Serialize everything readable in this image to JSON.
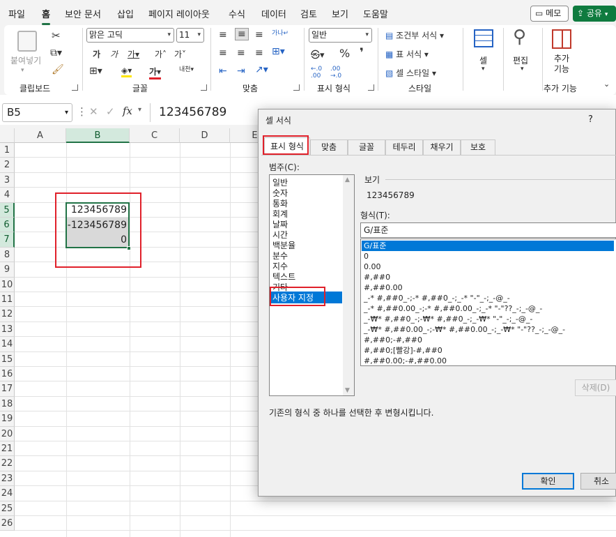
{
  "menu": {
    "tabs": [
      "파일",
      "홈",
      "보안 문서",
      "삽입",
      "페이지 레이아웃",
      "수식",
      "데이터",
      "검토",
      "보기",
      "도움말"
    ],
    "active_tab": "홈",
    "memo_label": "메모",
    "share_label": "공유"
  },
  "ribbon": {
    "paste_label": "붙여넣기",
    "font_name": "맑은 고딕",
    "font_size": "11",
    "number_format": "일반",
    "conditional_format": "조건부 서식",
    "table_format": "표 서식",
    "cell_style": "셀 스타일",
    "cells_label": "셀",
    "edit_label": "편집",
    "addins_label": "추가 기능",
    "groups": [
      "클립보드",
      "글꼴",
      "맞춤",
      "표시 형식",
      "스타일",
      "추가 기능"
    ]
  },
  "formula_bar": {
    "name_box": "B5",
    "formula": "123456789"
  },
  "sheet": {
    "columns": [
      "A",
      "B",
      "C",
      "D",
      "E"
    ],
    "rows": [
      "1",
      "2",
      "3",
      "4",
      "5",
      "6",
      "7",
      "8",
      "9",
      "10",
      "11",
      "12",
      "13",
      "14",
      "15",
      "16",
      "17",
      "18",
      "19",
      "20",
      "21",
      "22",
      "23",
      "24",
      "25",
      "26"
    ],
    "cells": {
      "B5": "123456789",
      "B6": "-123456789",
      "B7": "0"
    }
  },
  "dialog": {
    "title": "셀 서식",
    "help": "?",
    "tabs": [
      "표시 형식",
      "맞춤",
      "글꼴",
      "테두리",
      "채우기",
      "보호"
    ],
    "category_label": "범주(C):",
    "categories": [
      "일반",
      "숫자",
      "통화",
      "회계",
      "날짜",
      "시간",
      "백분율",
      "분수",
      "지수",
      "텍스트",
      "기타",
      "사용자 지정"
    ],
    "selected_category": "사용자 지정",
    "preview_label": "보기",
    "preview_value": "123456789",
    "type_label": "형식(T):",
    "type_value": "G/표준",
    "formats": [
      "G/표준",
      "0",
      "0.00",
      "#,##0",
      "#,##0.00",
      "_-* #,##0_-;-* #,##0_-;_-* \"-\"_-;_-@_-",
      "_-* #,##0.00_-;-* #,##0.00_-;_-* \"-\"??_-;_-@_-",
      "_-₩* #,##0_-;-₩* #,##0_-;_-₩* \"-\"_-;_-@_-",
      "_-₩* #,##0.00_-;-₩* #,##0.00_-;_-₩* \"-\"??_-;_-@_-",
      "#,##0;-#,##0",
      "#,##0;[빨강]-#,##0",
      "#,##0.00;-#,##0.00"
    ],
    "delete_label": "삭제(D)",
    "description": "기존의 형식 중 하나를 선택한 후 변형시킵니다.",
    "ok_label": "확인",
    "cancel_label": "취소"
  }
}
